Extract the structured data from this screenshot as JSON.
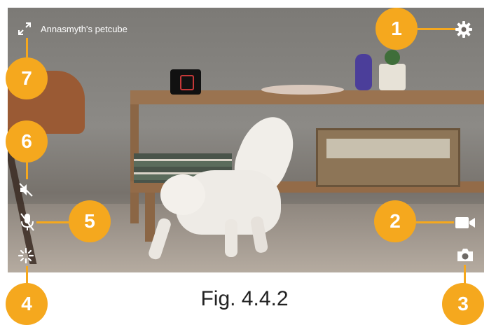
{
  "camera": {
    "name": "Annasmyth's petcube"
  },
  "icons": {
    "fullscreen": "fullscreen-icon",
    "settings": "gear-icon",
    "mute": "speaker-mute-icon",
    "mic_off": "microphone-off-icon",
    "laser": "laser-icon",
    "record": "video-camera-icon",
    "snapshot": "camera-icon"
  },
  "callouts": [
    "1",
    "2",
    "3",
    "4",
    "5",
    "6",
    "7"
  ],
  "caption": "Fig. 4.4.2",
  "colors": {
    "callout": "#f5a81e",
    "overlay_icon": "#ffffff"
  }
}
